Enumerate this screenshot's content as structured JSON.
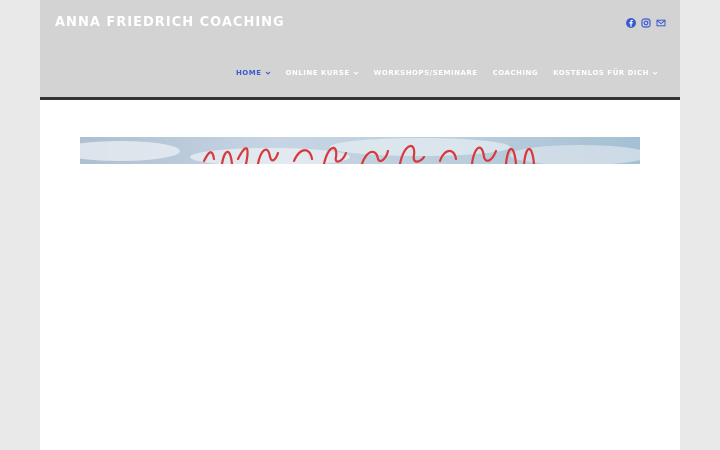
{
  "site": {
    "title": "ANNA FRIEDRICH COACHING"
  },
  "social": [
    {
      "name": "facebook-icon"
    },
    {
      "name": "instagram-icon"
    },
    {
      "name": "mail-icon"
    }
  ],
  "nav": {
    "items": [
      {
        "label": "HOME",
        "active": true,
        "dropdown": true
      },
      {
        "label": "ONLINE KURSE",
        "active": false,
        "dropdown": true
      },
      {
        "label": "WORKSHOPS/SEMINARE",
        "active": false,
        "dropdown": false
      },
      {
        "label": "COACHING",
        "active": false,
        "dropdown": false
      },
      {
        "label": "KOSTENLOS FÜR DICH",
        "active": false,
        "dropdown": true
      }
    ]
  },
  "colors": {
    "header_bg": "#d3d3d3",
    "accent": "#3d5bd1",
    "nav_text": "#ffffff",
    "header_border": "#333333",
    "hero_script": "#d9383a"
  }
}
